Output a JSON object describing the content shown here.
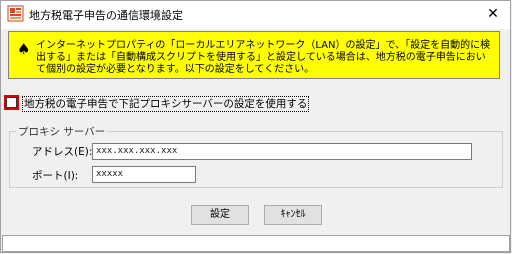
{
  "window": {
    "title": "地方税電子申告の通信環境設定",
    "close_glyph": "✕"
  },
  "notice": {
    "icon": "spade-icon",
    "text": "インターネットプロパティの「ローカルエリアネットワーク（LAN）の設定」で、「設定を自動的に検出する」または「自動構成スクリプトを使用する」と設定している場合は、地方税の電子申告において個別の設定が必要となります。以下の設定をしてください。"
  },
  "proxy_checkbox": {
    "label": "地方税の電子申告で下記プロキシサーバーの設定を使用する",
    "checked": false
  },
  "proxy_group": {
    "title": "プロキシ サーバー",
    "address_label": "アドレス(E):",
    "address_value": "xxx.xxx.xxx.xxx",
    "port_label": "ポート(I):",
    "port_value": "xxxxx"
  },
  "buttons": {
    "ok_label": "設定",
    "cancel_label": "ｷｬﾝｾﾙ"
  },
  "status": {
    "text": ""
  }
}
